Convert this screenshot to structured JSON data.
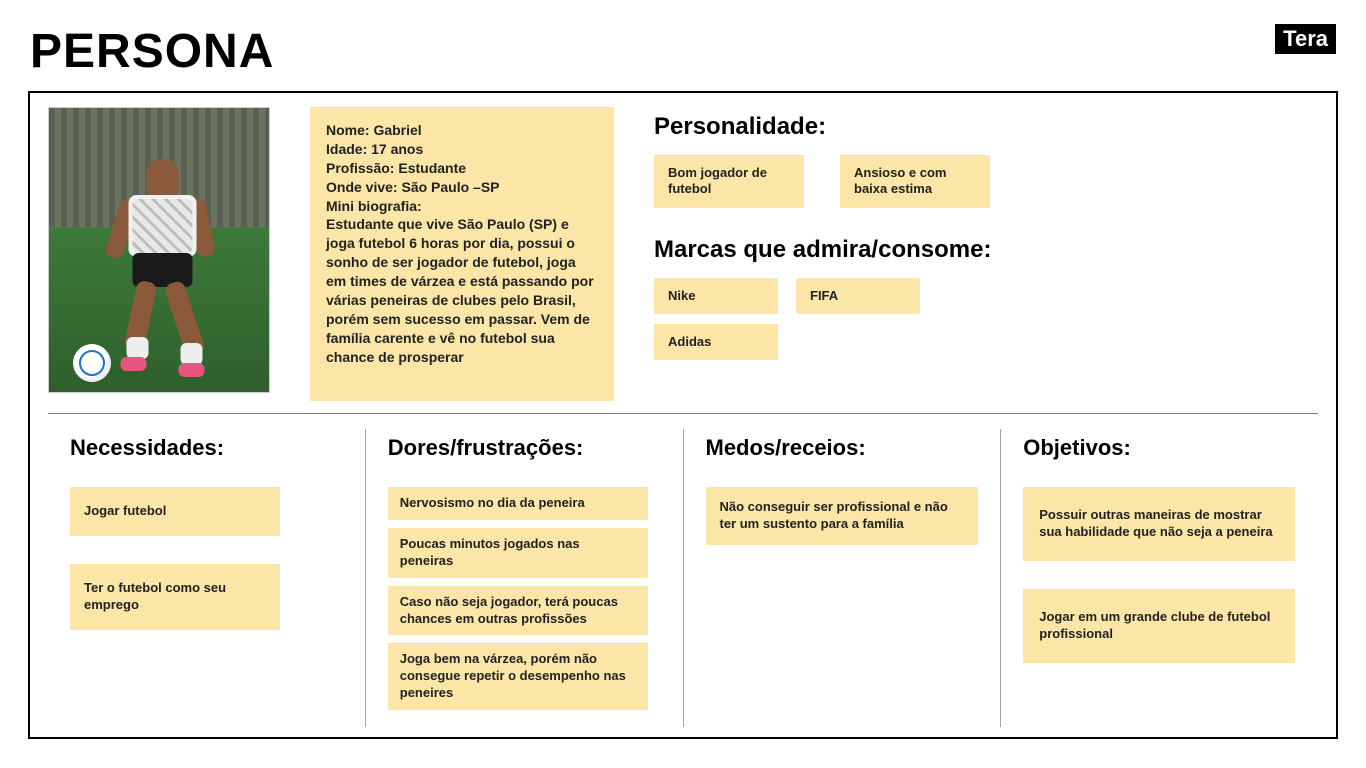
{
  "page_title": "PERSONA",
  "logo_text": "Tera",
  "bio": {
    "nome_label": "Nome:",
    "nome": "Gabriel",
    "idade_label": "Idade:",
    "idade": "17 anos",
    "profissao_label": "Profissão:",
    "profissao": "Estudante",
    "onde_label": "Onde vive:",
    "onde": "São Paulo –SP",
    "mini_bio_label": "Mini biografia:",
    "mini_bio": "Estudante que vive São Paulo (SP) e joga futebol 6 horas por dia, possui o sonho de ser jogador de futebol, joga em times de várzea e está passando por várias peneiras de clubes pelo Brasil, porém sem sucesso em passar. Vem de família carente e vê no futebol sua chance de prosperar"
  },
  "personalidade": {
    "title": "Personalidade:",
    "items": [
      "Bom jogador de futebol",
      "Ansioso e com baixa estima"
    ]
  },
  "marcas": {
    "title": "Marcas que admira/consome:",
    "items": [
      "Nike",
      "FIFA",
      "Adidas"
    ]
  },
  "necessidades": {
    "title": "Necessidades:",
    "items": [
      "Jogar futebol",
      "Ter o futebol como seu emprego"
    ]
  },
  "dores": {
    "title": "Dores/frustrações:",
    "items": [
      "Nervosismo no dia da peneira",
      "Poucas minutos jogados nas peneiras",
      "Caso não seja jogador, terá poucas chances em outras profissões",
      "Joga bem na várzea, porém não consegue repetir o desempenho nas peneires"
    ]
  },
  "medos": {
    "title": "Medos/receios:",
    "items": [
      "Não conseguir ser profissional e não ter um sustento para a família"
    ]
  },
  "objetivos": {
    "title": "Objetivos:",
    "items": [
      "Possuir outras maneiras de mostrar sua habilidade que não seja a peneira",
      "Jogar em um grande clube de futebol profissional"
    ]
  }
}
